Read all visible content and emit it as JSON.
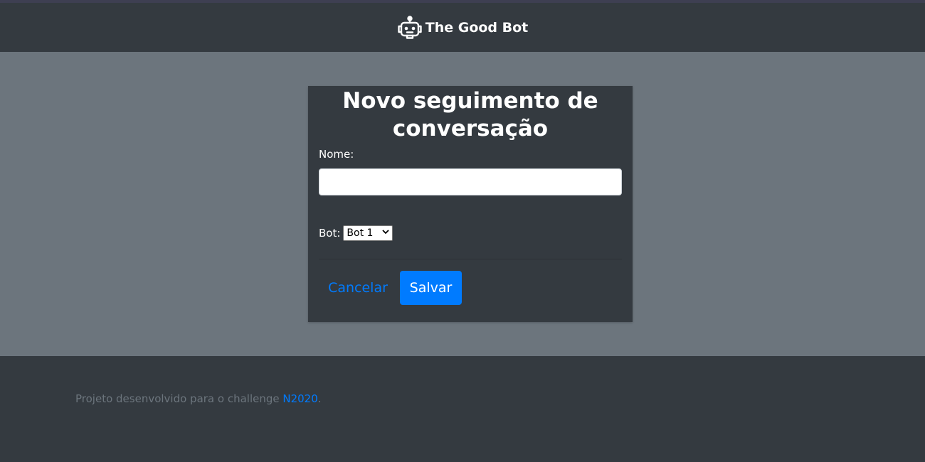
{
  "navbar": {
    "brand_name": "The Good Bot",
    "brand_icon": "robot-icon"
  },
  "form": {
    "title": "Novo seguimento de conversação",
    "name_label": "Nome:",
    "name_value": "",
    "name_placeholder": "",
    "bot_label": "Bot:",
    "bot_selected": "Bot 1",
    "cancel_label": "Cancelar",
    "save_label": "Salvar"
  },
  "footer": {
    "text_before": "Projeto desenvolvido para o challenge ",
    "link_text": "N2020",
    "text_after": "."
  },
  "colors": {
    "dark_bg": "#343a40",
    "main_bg": "#6c757d",
    "primary": "#007bff",
    "text_light": "#ffffff",
    "text_muted": "#6c757d"
  }
}
